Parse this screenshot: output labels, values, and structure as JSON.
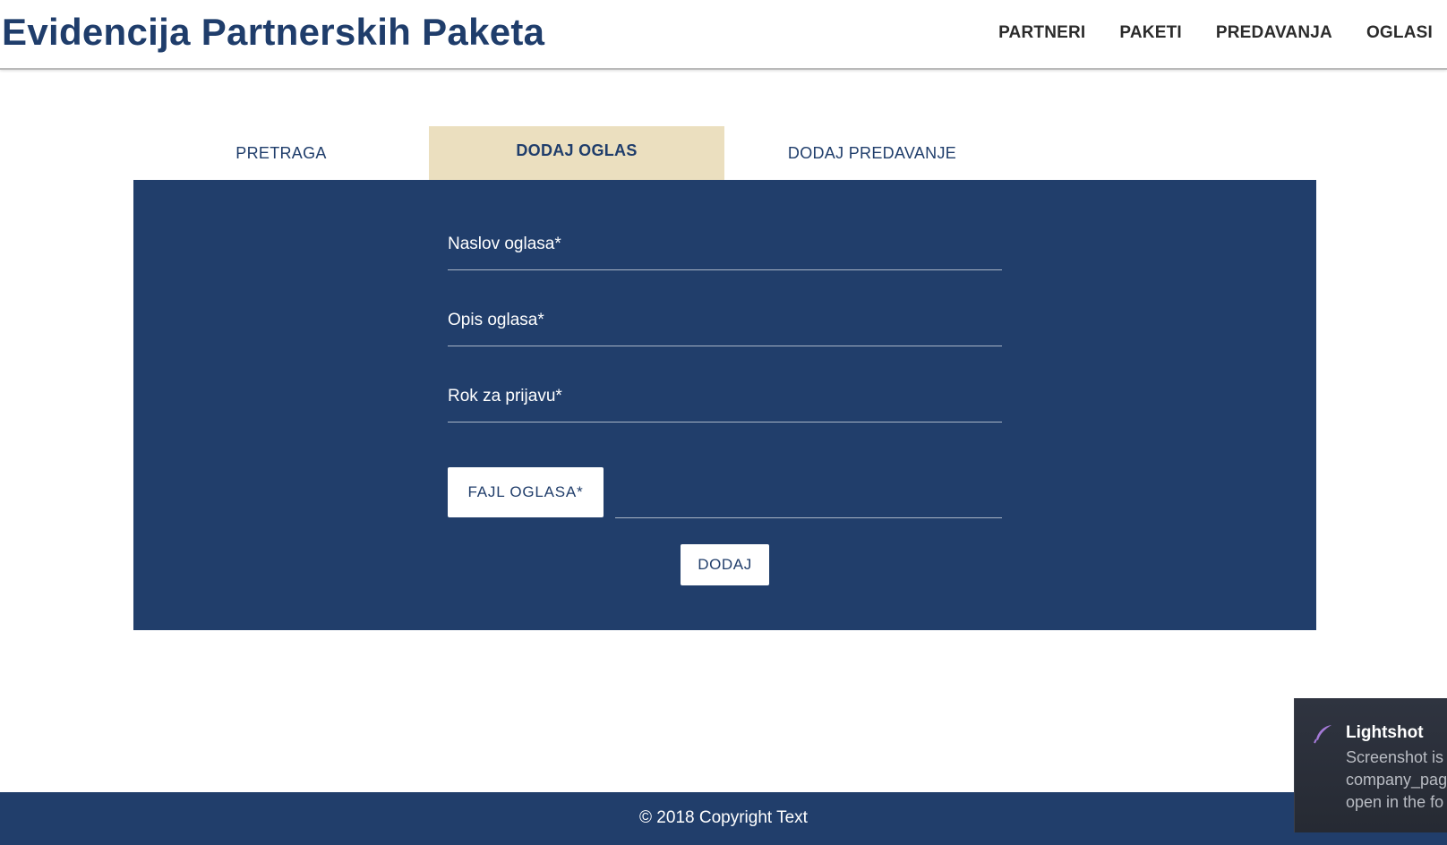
{
  "header": {
    "brand": "Evidencija Partnerskih Paketa",
    "nav": [
      "PARTNERI",
      "PAKETI",
      "PREDAVANJA",
      "OGLASI"
    ]
  },
  "tabs": [
    {
      "label": "PRETRAGA",
      "active": false
    },
    {
      "label": "DODAJ OGLAS",
      "active": true
    },
    {
      "label": "DODAJ PREDAVANJE",
      "active": false
    }
  ],
  "form": {
    "fields": [
      {
        "label": "Naslov oglasa*",
        "value": ""
      },
      {
        "label": "Opis oglasa*",
        "value": ""
      },
      {
        "label": "Rok za prijavu*",
        "value": ""
      }
    ],
    "file_button": "FAJL OGLASA*",
    "file_name": "",
    "submit": "DODAJ"
  },
  "footer": {
    "copyright": "© 2018 Copyright Text"
  },
  "toast": {
    "title": "Lightshot",
    "lines": [
      "Screenshot is",
      "company_pag",
      "open in the fo"
    ]
  },
  "colors": {
    "primary": "#213e6b",
    "brand_text": "#1f3d6b",
    "active_tab": "#ebdfbf",
    "toast_bg": "#2f3440",
    "toast_icon": "#a57ad8"
  }
}
